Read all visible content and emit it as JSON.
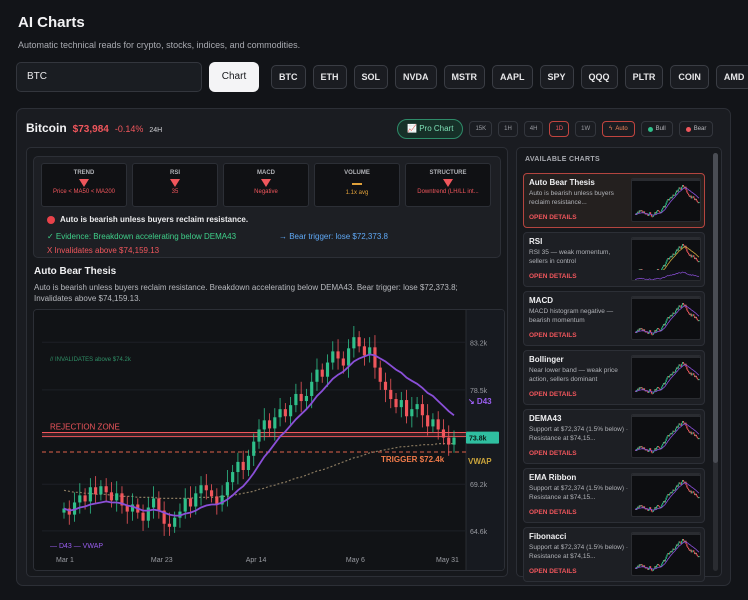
{
  "header": {
    "title": "AI Charts",
    "subtitle": "Automatic technical reads for crypto, stocks, indices, and commodities."
  },
  "search": {
    "value": "BTC"
  },
  "chart_button": "Chart",
  "tickers": [
    "BTC",
    "ETH",
    "SOL",
    "NVDA",
    "MSTR",
    "AAPL",
    "SPY",
    "QQQ",
    "PLTR",
    "COIN",
    "AMD"
  ],
  "asset": {
    "name": "Bitcoin",
    "price": "$73,984",
    "change": "-0.14%",
    "period": "24H"
  },
  "controls": {
    "pro_chart": "Pro Chart",
    "timeframes": [
      "15K",
      "1H",
      "4H",
      "1D",
      "1W"
    ],
    "active_timeframe": "1D",
    "modes": [
      "Auto",
      "Bull",
      "Bear"
    ]
  },
  "indicators": [
    {
      "title": "TREND",
      "value": "Price < MA50 < MA200",
      "state": "down"
    },
    {
      "title": "RSI",
      "value": "35",
      "state": "down"
    },
    {
      "title": "MACD",
      "value": "Negative",
      "state": "down"
    },
    {
      "title": "VOLUME",
      "value": "1.1x avg",
      "state": "neutral"
    },
    {
      "title": "STRUCTURE",
      "value": "Downtrend (LH/LL int...",
      "state": "down"
    }
  ],
  "summary": {
    "headline": "Auto is bearish unless buyers reclaim resistance.",
    "evidence": "✓ Evidence: Breakdown accelerating below DEMA43",
    "trigger": "→ Bear trigger: lose $72,373.8",
    "invalidation": "X  Invalidates above $74,159.13"
  },
  "thesis": {
    "title": "Auto Bear Thesis",
    "description": "Auto is bearish unless buyers reclaim resistance. Breakdown accelerating below DEMA43. Bear trigger: lose $72,373.8; Invalidates above $74,159.13."
  },
  "chart_data": {
    "type": "candlestick",
    "x_ticks": [
      "Mar 1",
      "Mar 23",
      "Apr 14",
      "May 6",
      "May 31"
    ],
    "y_ticks": [
      "83.2k",
      "78.5k",
      "73.8k",
      "69.2k",
      "64.6k"
    ],
    "ylim": [
      63.5,
      85.0
    ],
    "price_label": "73.8k",
    "annotations": {
      "invalidates": "// INVALIDATES above $74.2k",
      "rejection_zone": "REJECTION ZONE",
      "trigger": "TRIGGER $72.4k",
      "vwap": "VWAP",
      "d43": "↘ D43",
      "legend": "— D43 — VWAP"
    },
    "levels": {
      "invalidate": 74.16,
      "rejection_low": 73.9,
      "rejection_high": 74.3,
      "trigger": 72.37
    },
    "colors": {
      "up": "#2fbf8a",
      "down": "#f0565c",
      "dema": "#8a4fd8",
      "vwap": "#8a7a60"
    },
    "close": [
      66.8,
      66.2,
      67.4,
      68.1,
      67.5,
      68.9,
      68.2,
      69.0,
      68.4,
      67.6,
      68.3,
      67.1,
      66.5,
      67.2,
      66.4,
      65.6,
      66.9,
      67.8,
      66.6,
      65.3,
      65.0,
      65.9,
      66.5,
      67.8,
      67.0,
      68.3,
      69.1,
      68.6,
      68.0,
      67.2,
      68.1,
      69.4,
      70.4,
      71.4,
      70.6,
      72.0,
      73.4,
      74.6,
      75.5,
      74.7,
      75.8,
      76.6,
      75.9,
      77.0,
      78.1,
      77.4,
      77.9,
      79.3,
      80.5,
      79.8,
      81.2,
      82.3,
      81.6,
      80.9,
      82.6,
      83.7,
      82.8,
      81.9,
      82.7,
      80.7,
      79.3,
      78.5,
      77.6,
      76.8,
      77.5,
      75.9,
      76.6,
      77.1,
      76.0,
      74.9,
      75.6,
      74.6,
      73.8,
      73.1,
      73.8
    ],
    "dema43": [
      66.8,
      66.6,
      66.7,
      66.9,
      67.0,
      67.2,
      67.3,
      67.4,
      67.5,
      67.4,
      67.4,
      67.3,
      67.1,
      67.0,
      66.8,
      66.6,
      66.6,
      66.7,
      66.6,
      66.4,
      66.2,
      66.1,
      66.1,
      66.3,
      66.4,
      66.6,
      66.9,
      67.1,
      67.2,
      67.2,
      67.4,
      67.7,
      68.1,
      68.6,
      69.0,
      69.6,
      70.3,
      71.1,
      71.9,
      72.5,
      73.2,
      73.9,
      74.4,
      75.0,
      75.6,
      76.1,
      76.6,
      77.2,
      77.9,
      78.4,
      79.0,
      79.6,
      80.0,
      80.3,
      80.8,
      81.3,
      81.6,
      81.8,
      82.0,
      81.9,
      81.6,
      81.3,
      80.9,
      80.5,
      80.2,
      79.7,
      79.4,
      79.1,
      78.7,
      78.2,
      77.9,
      77.4,
      76.9,
      76.4,
      76.0
    ],
    "vwap": [
      68.6,
      68.5,
      68.4,
      68.4,
      68.3,
      68.3,
      68.2,
      68.2,
      68.2,
      68.1,
      68.1,
      68.0,
      68.0,
      68.0,
      67.9,
      67.9,
      67.9,
      67.9,
      67.8,
      67.8,
      67.8,
      67.8,
      67.8,
      67.8,
      67.8,
      67.9,
      67.9,
      67.9,
      67.9,
      67.9,
      68.0,
      68.0,
      68.1,
      68.2,
      68.3,
      68.4,
      68.5,
      68.7,
      68.8,
      69.0,
      69.1,
      69.3,
      69.4,
      69.6,
      69.8,
      69.9,
      70.1,
      70.3,
      70.5,
      70.6,
      70.8,
      71.0,
      71.2,
      71.4,
      71.6,
      71.8,
      71.9,
      72.1,
      72.3,
      72.4,
      72.5,
      72.6,
      72.7,
      72.8,
      72.9,
      72.9,
      73.0,
      73.0,
      73.1,
      73.1,
      73.1,
      73.2,
      73.2,
      73.2,
      73.2
    ]
  },
  "available_charts": {
    "title": "AVAILABLE CHARTS",
    "open_label": "OPEN DETAILS",
    "items": [
      {
        "title": "Auto Bear Thesis",
        "desc": "Auto is bearish unless buyers reclaim resistance...",
        "active": true
      },
      {
        "title": "RSI",
        "desc": "RSI 35 — weak momentum, sellers in control"
      },
      {
        "title": "MACD",
        "desc": "MACD histogram negative — bearish momentum"
      },
      {
        "title": "Bollinger",
        "desc": "Near lower band — weak price action, sellers dominant"
      },
      {
        "title": "DEMA43",
        "desc": "Support at $72,374 (1.5% below) · Resistance at $74,15..."
      },
      {
        "title": "EMA Ribbon",
        "desc": "Support at $72,374 (1.5% below) · Resistance at $74,15..."
      },
      {
        "title": "Fibonacci",
        "desc": "Support at $72,374 (1.5% below) · Resistance at $74,15..."
      }
    ]
  }
}
